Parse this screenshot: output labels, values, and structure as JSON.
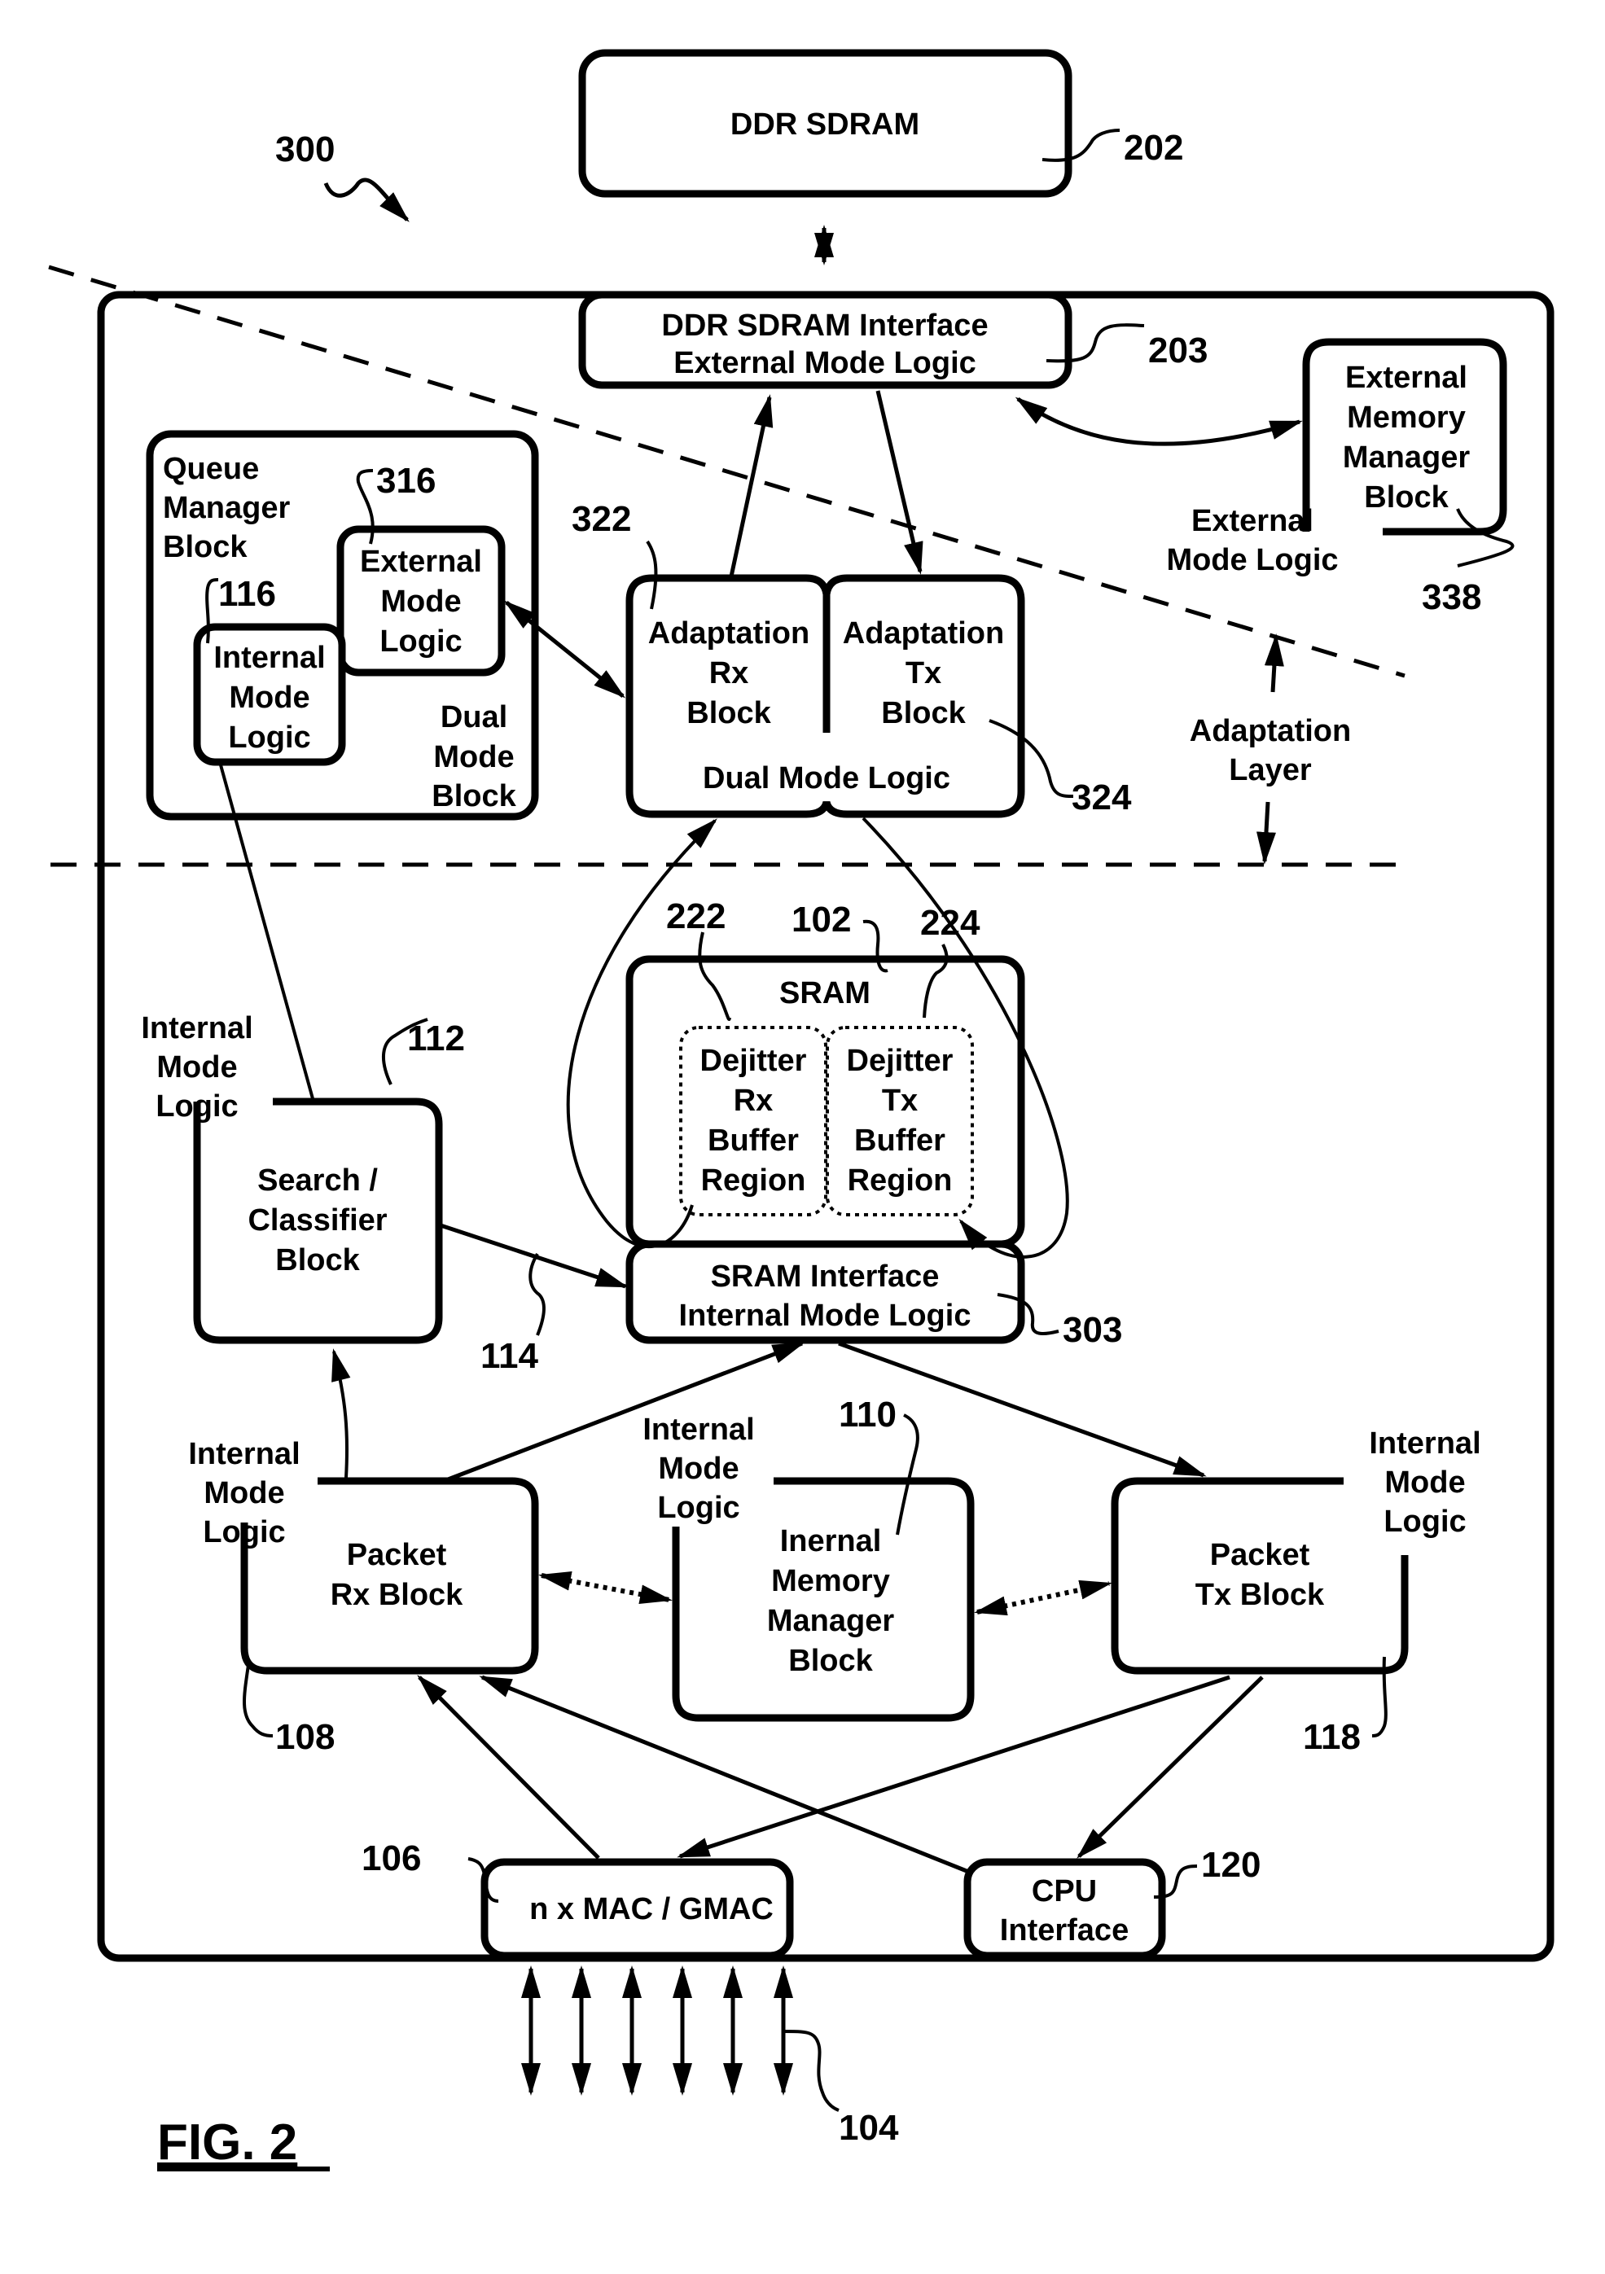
{
  "figure": {
    "label": "FIG. 2",
    "system_ref": "300"
  },
  "blocks": {
    "ddr_sdram": {
      "lines": [
        "DDR SDRAM"
      ],
      "ref": "202"
    },
    "ddr_interface": {
      "lines": [
        "DDR SDRAM Interface",
        "External Mode Logic"
      ],
      "ref": "203"
    },
    "ext_mem_mgr": {
      "lines": [
        "External",
        "Memory",
        "Manager",
        "Block"
      ],
      "ref": "338",
      "side_label": [
        "External",
        "Mode Logic"
      ]
    },
    "queue_mgr": {
      "lines": [
        "Queue",
        "Manager",
        "Block"
      ],
      "dual_mode": [
        "Dual",
        "Mode",
        "Block"
      ]
    },
    "qm_external": {
      "lines": [
        "External",
        "Mode",
        "Logic"
      ],
      "ref": "316"
    },
    "qm_internal": {
      "lines": [
        "Internal",
        "Mode",
        "Logic"
      ],
      "ref": "116"
    },
    "adapt_rx": {
      "lines": [
        "Adaptation",
        "Rx",
        "Block"
      ],
      "ref": "322"
    },
    "adapt_tx": {
      "lines": [
        "Adaptation",
        "Tx",
        "Block"
      ],
      "ref": "324"
    },
    "adapt_dual": {
      "label": "Dual Mode Logic"
    },
    "adaptation_layer": {
      "lines": [
        "Adaptation",
        "Layer"
      ]
    },
    "sram": {
      "title": "SRAM",
      "ref": "102"
    },
    "dejitter_rx": {
      "lines": [
        "Dejitter",
        "Rx",
        "Buffer",
        "Region"
      ],
      "ref": "222"
    },
    "dejitter_tx": {
      "lines": [
        "Dejitter",
        "Tx",
        "Buffer",
        "Region"
      ],
      "ref": "224"
    },
    "sram_interface": {
      "lines": [
        "SRAM Interface",
        "Internal Mode Logic"
      ],
      "ref": "303"
    },
    "search": {
      "lines": [
        "Search /",
        "Classifier",
        "Block"
      ],
      "ref": "112",
      "side_label": [
        "Internal",
        "Mode",
        "Logic"
      ],
      "link_ref": "114"
    },
    "packet_rx": {
      "lines": [
        "Packet",
        "Rx Block"
      ],
      "ref": "108",
      "side_label": [
        "Internal",
        "Mode",
        "Logic"
      ]
    },
    "int_mem_mgr": {
      "lines": [
        "Inernal",
        "Memory",
        "Manager",
        "Block"
      ],
      "ref": "110",
      "side_label": [
        "Internal",
        "Mode",
        "Logic"
      ]
    },
    "packet_tx": {
      "lines": [
        "Packet",
        "Tx Block"
      ],
      "ref": "118",
      "side_label": [
        "Internal",
        "Mode",
        "Logic"
      ]
    },
    "mac": {
      "lines": [
        "n x MAC / GMAC"
      ],
      "ref": "106",
      "ports_ref": "104"
    },
    "cpu": {
      "lines": [
        "CPU",
        "Interface"
      ],
      "ref": "120"
    }
  }
}
